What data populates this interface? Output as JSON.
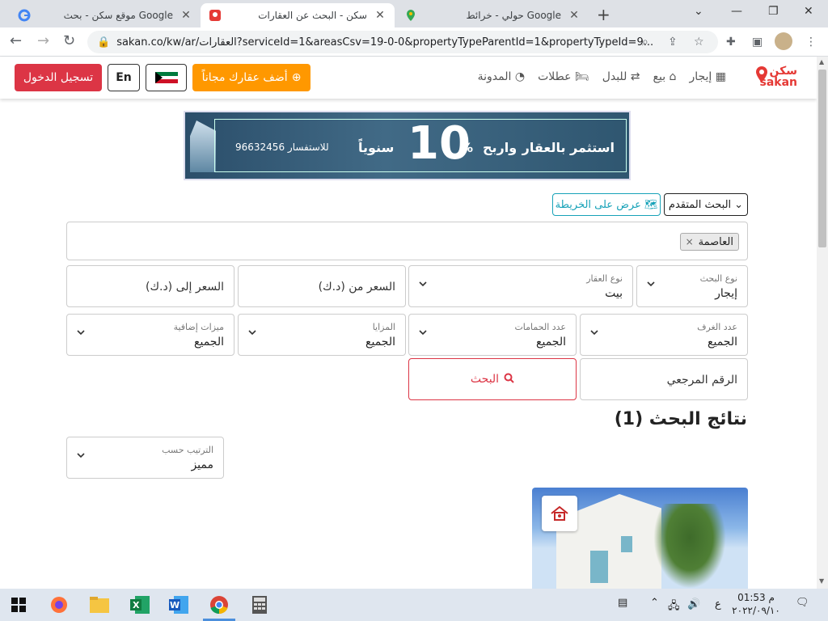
{
  "browser": {
    "tabs": [
      {
        "title": "موقع سكن - بحث Google",
        "icon": "google-icon",
        "active": false
      },
      {
        "title": "سكن - البحث عن العقارات",
        "icon": "sakan-icon",
        "active": true
      },
      {
        "title": "حولي - خرائط Google",
        "icon": "google-maps-icon",
        "active": false
      }
    ],
    "url": "sakan.co/kw/ar/العقارات?serviceId=1&areasCsv=19-0-0&propertyTypeParentId=1&propertyTypeId=9..."
  },
  "header": {
    "login_label": "تسجيل الدخول",
    "lang_label": "En",
    "add_property_label": "أضف عقارك مجاناً",
    "nav": [
      "إيجار",
      "بيع",
      "للبدل",
      "عطلات",
      "المدونة"
    ],
    "logo_ar": "سكن",
    "logo_en": "sakan",
    "brand_color": "#e53935"
  },
  "banner": {
    "big_text": "10",
    "percent": "%",
    "text_right": "استثمر بالعقار",
    "text_middle": "واربح",
    "text_left": "سنوياً",
    "phone": "للاستفسار 96632456"
  },
  "search": {
    "advanced_label": "البحث المتقدم",
    "map_label": "عرض على الخريطة",
    "area_chip": "العاصمة",
    "search_type": {
      "label": "نوع البحث",
      "value": "إيجار"
    },
    "property_type": {
      "label": "نوع العقار",
      "value": "بيت"
    },
    "price_from": "السعر من (د.ك)",
    "price_to": "السعر إلى (د.ك)",
    "rooms": {
      "label": "عدد الغرف",
      "value": "الجميع"
    },
    "baths": {
      "label": "عدد الحمامات",
      "value": "الجميع"
    },
    "features": {
      "label": "المزايا",
      "value": "الجميع"
    },
    "extra": {
      "label": "ميزات إضافية",
      "value": "الجميع"
    },
    "reference": "الرقم المرجعي",
    "search_button": "البحث"
  },
  "results": {
    "title": "نتائج البحث (1)",
    "sort": {
      "label": "الترتيب حسب",
      "value": "مميز"
    }
  },
  "taskbar": {
    "time": "01:53 م",
    "date": "٢٠٢٢/٠٩/١٠",
    "lang": "ع"
  }
}
